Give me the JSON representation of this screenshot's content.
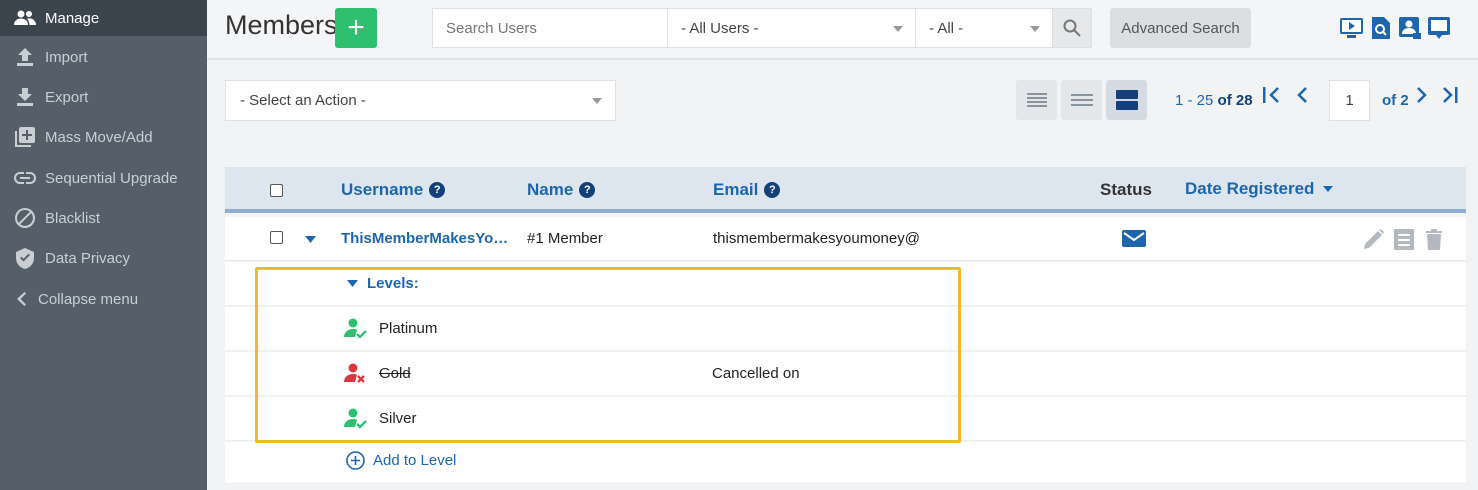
{
  "sidebar": {
    "items": [
      {
        "label": "Manage",
        "icon": "users-icon"
      },
      {
        "label": "Import",
        "icon": "upload-icon"
      },
      {
        "label": "Export",
        "icon": "download-icon"
      },
      {
        "label": "Mass Move/Add",
        "icon": "mass-add-icon"
      },
      {
        "label": "Sequential Upgrade",
        "icon": "link-icon"
      },
      {
        "label": "Blacklist",
        "icon": "ban-icon"
      },
      {
        "label": "Data Privacy",
        "icon": "shield-icon"
      },
      {
        "label": "Collapse menu",
        "icon": "chevron-left-icon"
      }
    ]
  },
  "header": {
    "title": "Members",
    "add_symbol": "+",
    "search_placeholder": "Search Users",
    "user_filter": "- All Users -",
    "status_filter": "- All -",
    "advanced_search": "Advanced Search"
  },
  "actions": {
    "select_action": "- Select an Action -"
  },
  "pager": {
    "range": "1 - 25",
    "of_total": "of 28",
    "current_page": "1",
    "of_pages": "of 2"
  },
  "table": {
    "columns": {
      "username": "Username",
      "name": "Name",
      "email": "Email",
      "status": "Status",
      "date_registered": "Date Registered"
    },
    "row": {
      "username": "ThisMemberMakesYo…",
      "name": "#1 Member",
      "email": "thismembermakesyoumoney@"
    },
    "levels_label": "Levels:",
    "levels": [
      {
        "name": "Platinum",
        "state": "active",
        "note": ""
      },
      {
        "name": "Gold",
        "state": "cancelled",
        "note": "Cancelled on"
      },
      {
        "name": "Silver",
        "state": "active",
        "note": ""
      }
    ],
    "add_to_level": "Add to Level"
  },
  "colors": {
    "sidebar_bg": "#555f69",
    "sidebar_active": "#3b444d",
    "accent_green": "#2fbf71",
    "link_blue": "#1d66ad",
    "cancel_red": "#d9363e",
    "highlight": "#f5b72c"
  }
}
